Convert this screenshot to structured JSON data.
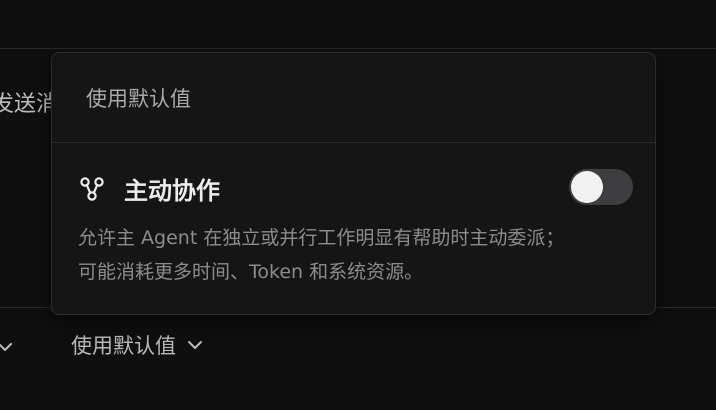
{
  "background": {
    "partial_text": "发送消",
    "default_select_label": "使用默认值"
  },
  "popover": {
    "option_label": "使用默认值",
    "feature": {
      "title": "主动协作",
      "toggle_on": false,
      "description_line1": "允许主 Agent 在独立或并行工作明显有帮助时主动委派；",
      "description_line2": "可能消耗更多时间、Token 和系统资源。"
    }
  },
  "icons": {
    "feature_icon": "branch-nodes-icon",
    "chevron": "chevron-down-icon"
  }
}
